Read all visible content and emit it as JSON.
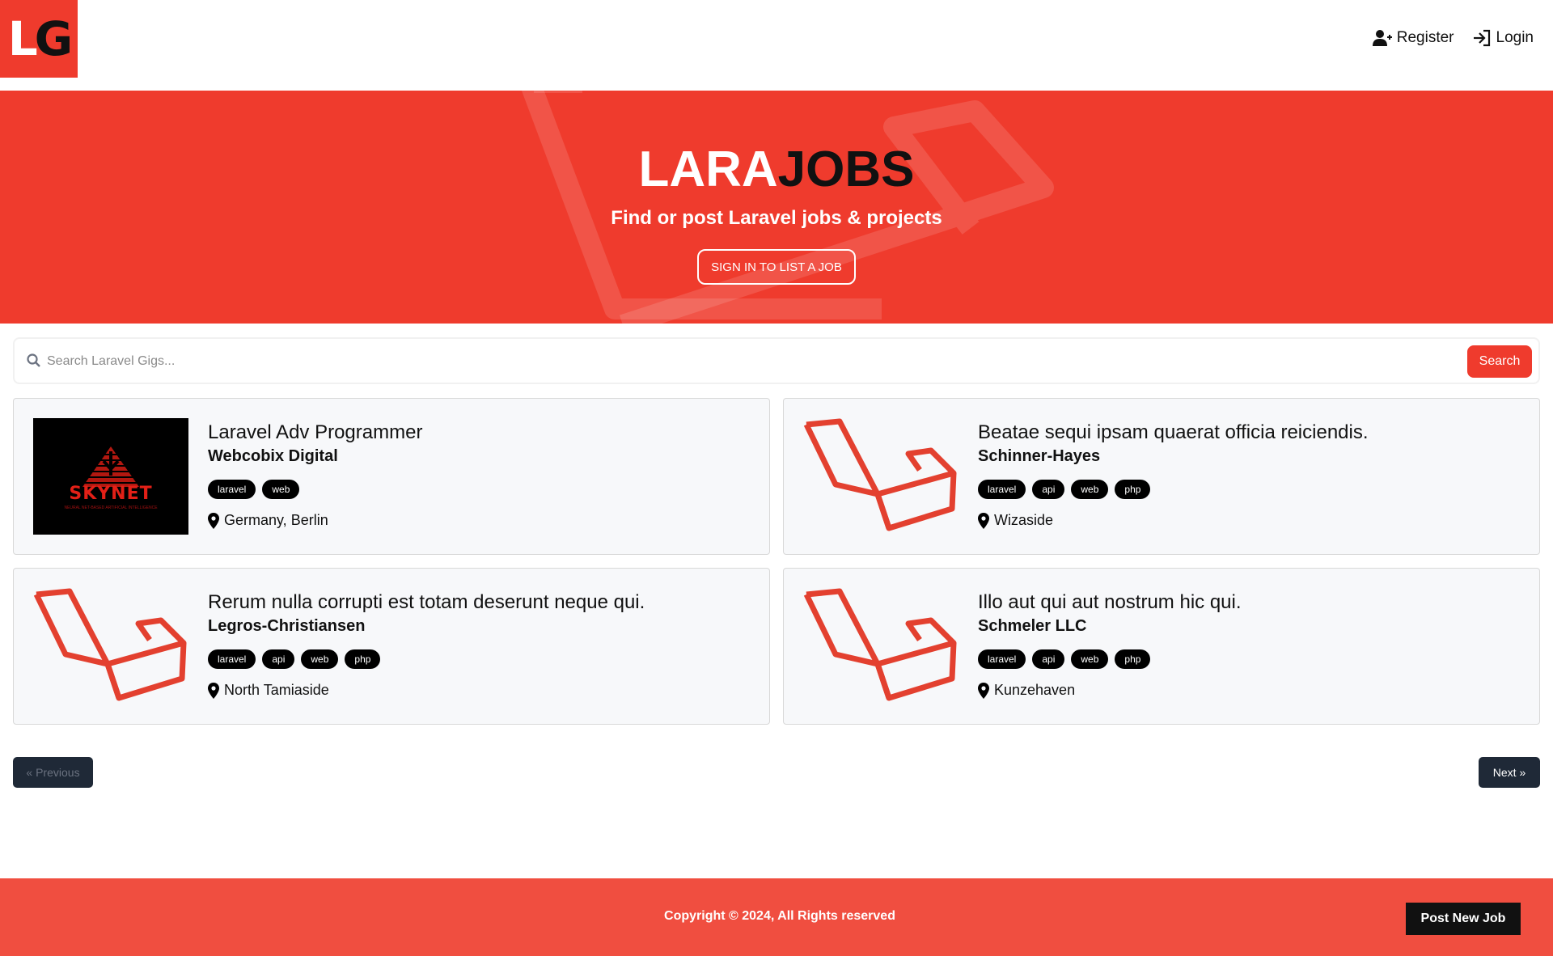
{
  "nav": {
    "logo_l": "L",
    "logo_g": "G",
    "register_label": "Register",
    "login_label": "Login"
  },
  "hero": {
    "title_white": "LARA",
    "title_black": "JOBS",
    "subtitle": "Find or post Laravel jobs & projects",
    "cta_label": "SIGN IN TO LIST A JOB"
  },
  "search": {
    "placeholder": "Search Laravel Gigs...",
    "button_label": "Search"
  },
  "listings": [
    {
      "title": "Laravel Adv Programmer",
      "company": "Webcobix Digital",
      "tags": [
        "laravel",
        "web"
      ],
      "location": "Germany, Berlin",
      "logo": "skynet"
    },
    {
      "title": "Beatae sequi ipsam quaerat officia reiciendis.",
      "company": "Schinner-Hayes",
      "tags": [
        "laravel",
        "api",
        "web",
        "php"
      ],
      "location": "Wizaside",
      "logo": "laravel"
    },
    {
      "title": "Rerum nulla corrupti est totam deserunt neque qui.",
      "company": "Legros-Christiansen",
      "tags": [
        "laravel",
        "api",
        "web",
        "php"
      ],
      "location": "North Tamiaside",
      "logo": "laravel"
    },
    {
      "title": "Illo aut qui aut nostrum hic qui.",
      "company": "Schmeler LLC",
      "tags": [
        "laravel",
        "api",
        "web",
        "php"
      ],
      "location": "Kunzehaven",
      "logo": "laravel"
    }
  ],
  "skynet_logo": {
    "word": "SKYNET",
    "small": "NEURAL NET-BASED ARTIFICIAL INTELLIGENCE"
  },
  "pagination": {
    "prev_label": "« Previous",
    "next_label": "Next »"
  },
  "footer": {
    "copyright": "Copyright © 2024, All Rights reserved",
    "post_label": "Post New Job"
  },
  "colors": {
    "brand_red": "#ef3b2d",
    "footer_red": "#f04e40",
    "dark": "#1f2937"
  }
}
